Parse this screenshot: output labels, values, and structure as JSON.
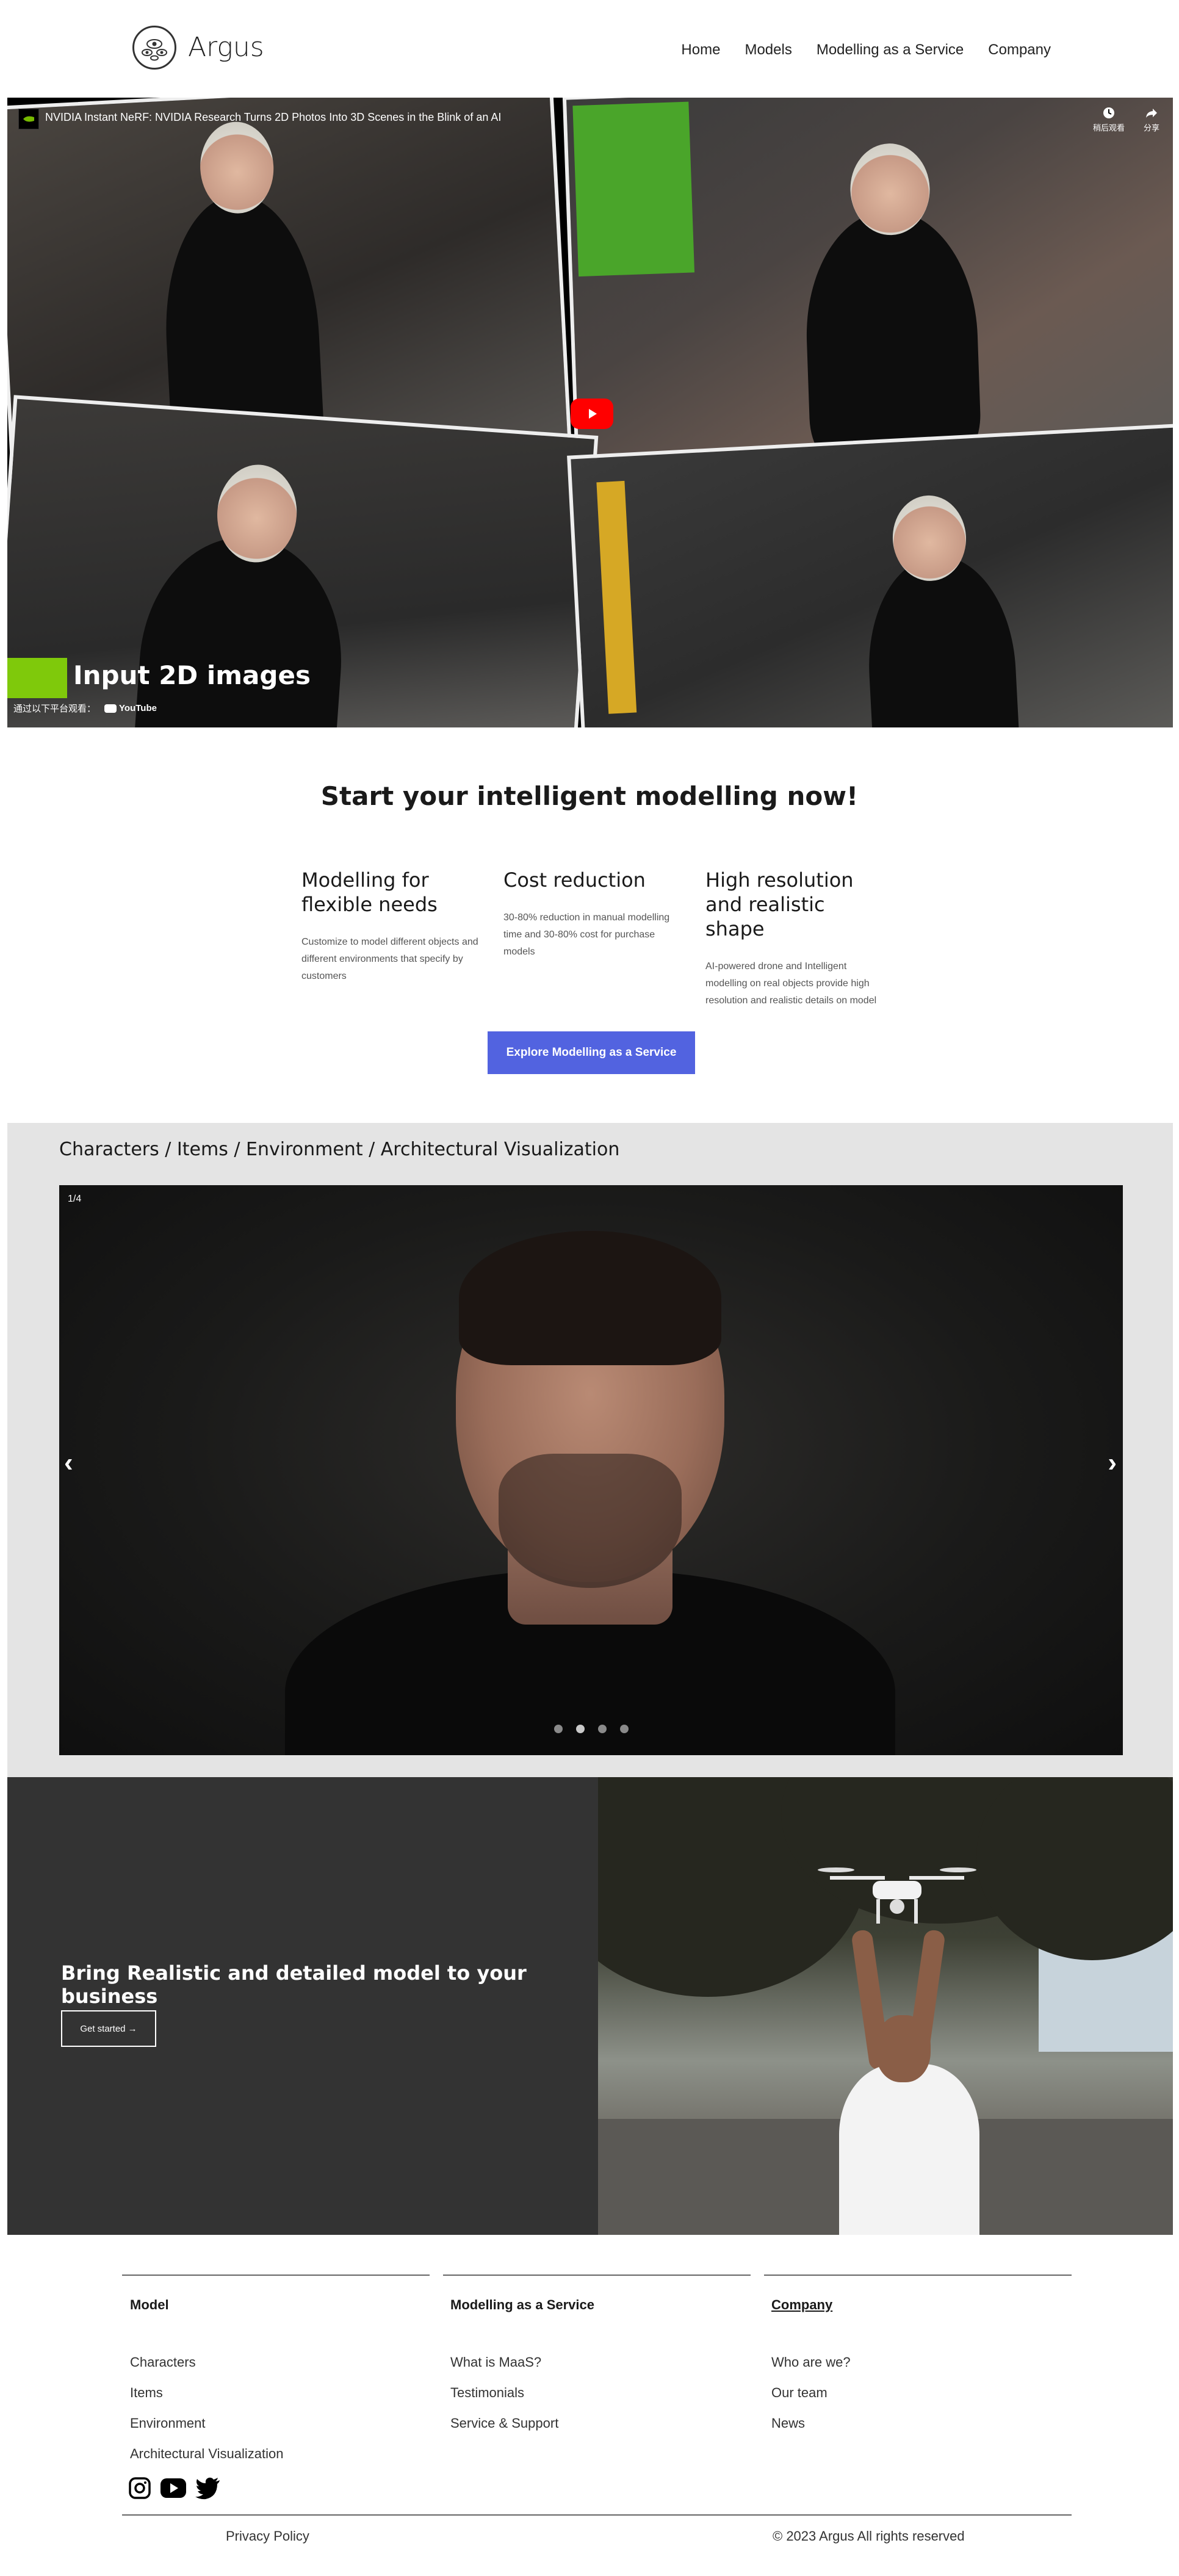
{
  "header": {
    "brand": "Argus",
    "nav": [
      "Home",
      "Models",
      "Modelling as a Service",
      "Company"
    ]
  },
  "video": {
    "title": "NVIDIA Instant NeRF: NVIDIA Research Turns 2D Photos Into 3D Scenes in the Blink of an AI",
    "watch_later": "稍后观看",
    "share": "分享",
    "caption": "Input 2D images",
    "watch_on": "通过以下平台观看：",
    "youtube": "YouTube"
  },
  "intro": {
    "title": "Start your intelligent modelling now!",
    "features": [
      {
        "title": "Modelling for flexible needs",
        "text": "Customize to model different objects and different environments that specify by customers"
      },
      {
        "title": "Cost reduction",
        "text": "30-80% reduction in manual modelling time and 30-80% cost for purchase models"
      },
      {
        "title": "High resolution and realistic shape",
        "text": "AI-powered drone and Intelligent modelling on real objects provide high resolution and realistic details on model"
      }
    ],
    "cta": "Explore Modelling as a Service"
  },
  "gallery": {
    "title": "Characters / Items / Environment / Architectural Visualization",
    "counter": "1/4",
    "prev": "‹",
    "next": "›",
    "slide_count": 4,
    "active_slide": 1
  },
  "business": {
    "title": "Bring Realistic and detailed model to your business",
    "button": "Get started →"
  },
  "footer": {
    "columns": [
      {
        "title": "Model",
        "items": [
          "Characters",
          "Items",
          "Environment",
          "Architectural Visualization"
        ]
      },
      {
        "title": "Modelling as a Service",
        "items": [
          "What is MaaS?",
          "Testimonials",
          "Service & Support"
        ]
      },
      {
        "title": "Company",
        "items": [
          "Who are we?",
          "Our team",
          "News"
        ]
      }
    ],
    "social": [
      "instagram-icon",
      "youtube-icon",
      "twitter-icon"
    ],
    "privacy": "Privacy Policy",
    "copyright": "© 2023 Argus All rights reserved"
  }
}
